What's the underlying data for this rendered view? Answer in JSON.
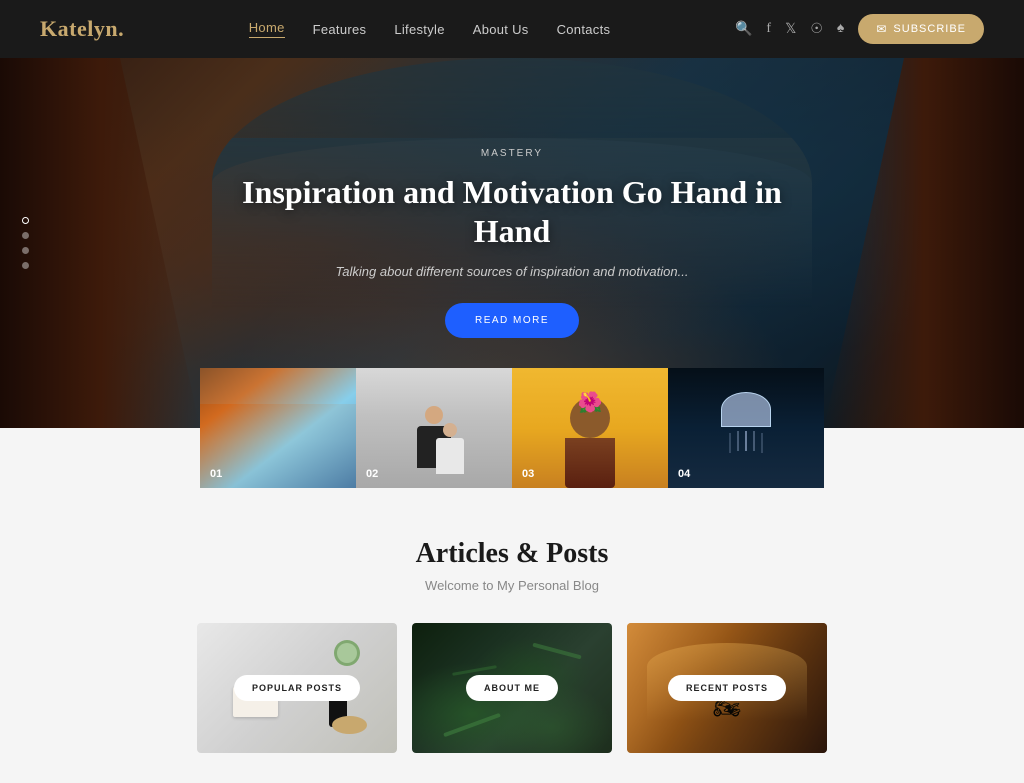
{
  "brand": {
    "name": "Katelyn",
    "dot": "."
  },
  "nav": {
    "items": [
      {
        "label": "Home",
        "active": true
      },
      {
        "label": "Features",
        "active": false
      },
      {
        "label": "Lifestyle",
        "active": false
      },
      {
        "label": "About Us",
        "active": false
      },
      {
        "label": "Contacts",
        "active": false
      }
    ]
  },
  "header": {
    "subscribe_label": "SUBSCRIBE"
  },
  "hero": {
    "category": "MASTERY",
    "title": "Inspiration and Motivation Go Hand in Hand",
    "subtitle": "Talking about different sources of inspiration and motivation...",
    "cta": "READ MORE",
    "slides": [
      "01",
      "02",
      "03",
      "04"
    ]
  },
  "gallery": {
    "items": [
      {
        "num": "01",
        "type": "canyon"
      },
      {
        "num": "02",
        "type": "fashion"
      },
      {
        "num": "03",
        "type": "portrait"
      },
      {
        "num": "04",
        "type": "jellyfish"
      }
    ]
  },
  "articles": {
    "section_title": "Articles & Posts",
    "section_subtitle": "Welcome to My Personal Blog",
    "cards": [
      {
        "label": "POPULAR POSTS",
        "type": "desk"
      },
      {
        "label": "ABOUT ME",
        "type": "fern"
      },
      {
        "label": "RECENT POSTS",
        "type": "moto"
      }
    ]
  }
}
